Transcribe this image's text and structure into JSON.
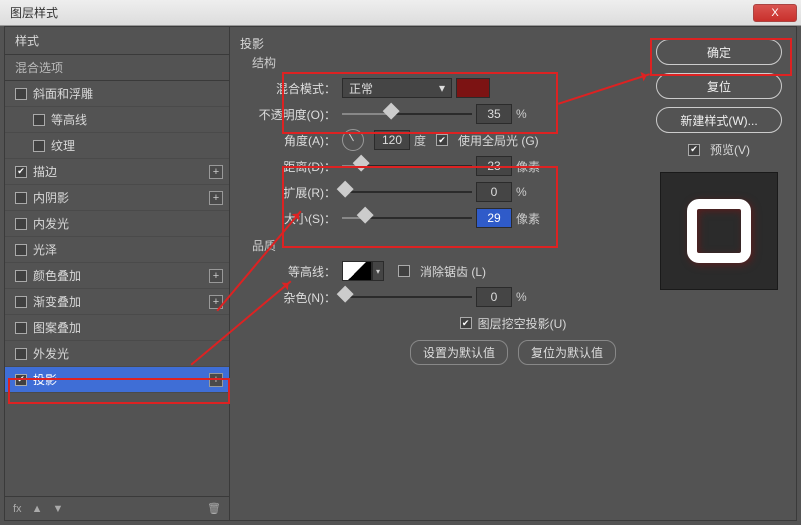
{
  "window": {
    "title": "图层样式",
    "close_x": "X"
  },
  "sidebar": {
    "header": "样式",
    "blend": "混合选项",
    "items": [
      {
        "label": "斜面和浮雕",
        "checked": false,
        "add": false,
        "indent": false
      },
      {
        "label": "等高线",
        "checked": false,
        "add": false,
        "indent": true
      },
      {
        "label": "纹理",
        "checked": false,
        "add": false,
        "indent": true
      },
      {
        "label": "描边",
        "checked": true,
        "add": true,
        "indent": false
      },
      {
        "label": "内阴影",
        "checked": false,
        "add": true,
        "indent": false
      },
      {
        "label": "内发光",
        "checked": false,
        "add": false,
        "indent": false
      },
      {
        "label": "光泽",
        "checked": false,
        "add": false,
        "indent": false
      },
      {
        "label": "颜色叠加",
        "checked": false,
        "add": true,
        "indent": false
      },
      {
        "label": "渐变叠加",
        "checked": false,
        "add": true,
        "indent": false
      },
      {
        "label": "图案叠加",
        "checked": false,
        "add": false,
        "indent": false
      },
      {
        "label": "外发光",
        "checked": false,
        "add": false,
        "indent": false
      },
      {
        "label": "投影",
        "checked": true,
        "add": true,
        "indent": false,
        "selected": true
      }
    ],
    "footer": {
      "fx": "fx",
      "up": "▲",
      "down": "▼",
      "trash": "🗑"
    }
  },
  "main": {
    "title": "投影",
    "structure_label": "结构",
    "blend_mode": {
      "label": "混合模式：",
      "value": "正常",
      "color": "#7C1313"
    },
    "opacity": {
      "label": "不透明度(O)：",
      "value": "35",
      "unit": "%"
    },
    "angle": {
      "label": "角度(A)：",
      "value": "120",
      "unit": "度",
      "global_label": "使用全局光 (G)",
      "global_checked": true
    },
    "distance": {
      "label": "距离(D)：",
      "value": "23",
      "unit": "像素"
    },
    "spread": {
      "label": "扩展(R)：",
      "value": "0",
      "unit": "%"
    },
    "size": {
      "label": "大小(S)：",
      "value": "29",
      "unit": "像素"
    },
    "quality_label": "品质",
    "contour": {
      "label": "等高线：",
      "antialias_label": "消除锯齿 (L)",
      "antialias_checked": false
    },
    "noise": {
      "label": "杂色(N)：",
      "value": "0",
      "unit": "%"
    },
    "knockout": {
      "label": "图层挖空投影(U)",
      "checked": true
    },
    "defaults": {
      "set": "设置为默认值",
      "reset": "复位为默认值"
    }
  },
  "right": {
    "ok": "确定",
    "cancel": "复位",
    "new_style": "新建样式(W)...",
    "preview_label": "预览(V)",
    "preview_checked": true
  }
}
